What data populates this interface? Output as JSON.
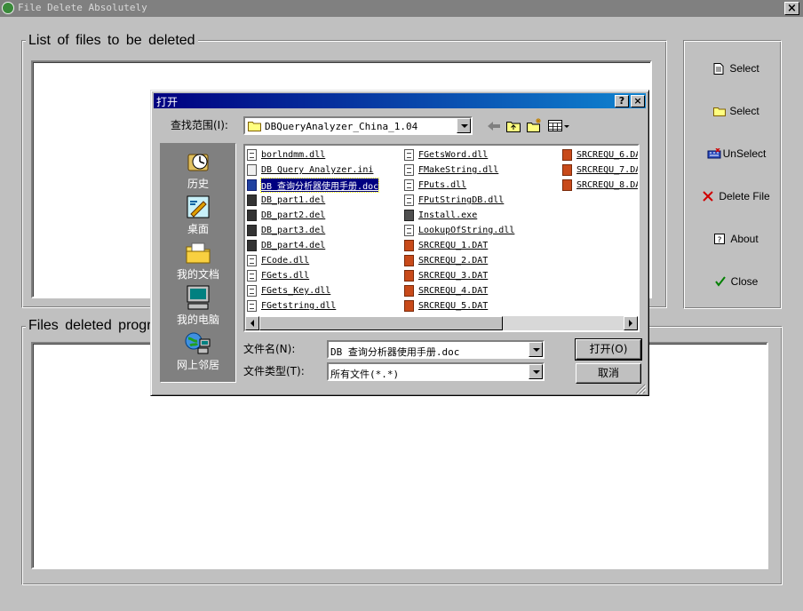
{
  "window": {
    "title": "File Delete Absolutely",
    "close": "×"
  },
  "groups": {
    "list_title": "List of files to be deleted",
    "progress_title": "Files deleted progress"
  },
  "side_buttons": [
    {
      "label": "Select",
      "icon": "file-icon"
    },
    {
      "label": "Select",
      "icon": "folder-icon"
    },
    {
      "label": "UnSelect",
      "icon": "keyboard-icon"
    },
    {
      "label": "Delete File",
      "icon": "red-x-icon"
    },
    {
      "label": "About",
      "icon": "question-icon"
    },
    {
      "label": "Close",
      "icon": "check-icon"
    }
  ],
  "dialog": {
    "title": "打开",
    "help": "?",
    "close": "×",
    "lookin_label": "查找范围(I):",
    "lookin_value": "DBQueryAnalyzer_China_1.04",
    "places": [
      {
        "label": "历史",
        "icon": "history-icon"
      },
      {
        "label": "桌面",
        "icon": "desktop-icon"
      },
      {
        "label": "我的文档",
        "icon": "my-documents-icon"
      },
      {
        "label": "我的电脑",
        "icon": "my-computer-icon"
      },
      {
        "label": "网上邻居",
        "icon": "network-icon"
      }
    ],
    "columns": [
      [
        {
          "name": "borlndmm.dll",
          "type": "dll"
        },
        {
          "name": "DB Query Analyzer.ini",
          "type": "ini"
        },
        {
          "name": "DB 查询分析器使用手册.doc",
          "type": "doc"
        },
        {
          "name": "DB_part1.del",
          "type": "del"
        },
        {
          "name": "DB_part2.del",
          "type": "del"
        },
        {
          "name": "DB_part3.del",
          "type": "del"
        },
        {
          "name": "DB_part4.del",
          "type": "del"
        },
        {
          "name": "FCode.dll",
          "type": "dll"
        },
        {
          "name": "FGets.dll",
          "type": "dll"
        },
        {
          "name": "FGets_Key.dll",
          "type": "dll"
        },
        {
          "name": "FGetstring.dll",
          "type": "dll"
        }
      ],
      [
        {
          "name": "FGetsWord.dll",
          "type": "dll"
        },
        {
          "name": "FMakeString.dll",
          "type": "dll"
        },
        {
          "name": "FPuts.dll",
          "type": "dll"
        },
        {
          "name": "FPutStringDB.dll",
          "type": "dll"
        },
        {
          "name": "Install.exe",
          "type": "exe"
        },
        {
          "name": "LookupOfString.dll",
          "type": "dll"
        },
        {
          "name": "SRCREQU_1.DAT",
          "type": "dat"
        },
        {
          "name": "SRCREQU_2.DAT",
          "type": "dat"
        },
        {
          "name": "SRCREQU_3.DAT",
          "type": "dat"
        },
        {
          "name": "SRCREQU_4.DAT",
          "type": "dat"
        },
        {
          "name": "SRCREQU_5.DAT",
          "type": "dat"
        }
      ],
      [
        {
          "name": "SRCREQU_6.DA",
          "type": "dat"
        },
        {
          "name": "SRCREQU_7.DA",
          "type": "dat"
        },
        {
          "name": "SRCREQU_8.DA",
          "type": "dat"
        }
      ]
    ],
    "filename_label": "文件名(N):",
    "filename_value": "DB 查询分析器使用手册.doc",
    "filetype_label": "文件类型(T):",
    "filetype_value": "所有文件(*.*)",
    "open_button": "打开(O)",
    "cancel_button": "取消"
  }
}
